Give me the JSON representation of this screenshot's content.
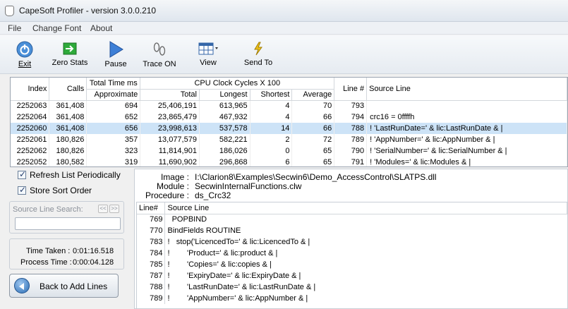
{
  "window": {
    "title": "CapeSoft Profiler - version  3.0.0.210"
  },
  "menu": [
    "File",
    "Change Font",
    "About"
  ],
  "toolbar": [
    {
      "label": "Exit",
      "icon": "power-icon"
    },
    {
      "label": "Zero Stats",
      "icon": "green-arrow-icon"
    },
    {
      "label": "Pause",
      "icon": "play-icon"
    },
    {
      "label": "Trace ON",
      "icon": "footprints-icon"
    },
    {
      "label": "View",
      "icon": "grid-view-icon"
    },
    {
      "label": "Send To",
      "icon": "lightning-icon"
    }
  ],
  "grid": {
    "header_top": [
      "Index",
      "Calls",
      "Total Time ms",
      "CPU Clock Cycles X 100",
      "Line #",
      "Source Line"
    ],
    "header_sub": [
      "Approximate",
      "Total",
      "Longest",
      "Shortest",
      "Average"
    ],
    "rows": [
      {
        "index": "2252063",
        "calls": "361,408",
        "approx": "694",
        "total": "25,406,191",
        "longest": "613,965",
        "shortest": "4",
        "average": "70",
        "line": "793",
        "source": ""
      },
      {
        "index": "2252064",
        "calls": "361,408",
        "approx": "652",
        "total": "23,865,479",
        "longest": "467,932",
        "shortest": "4",
        "average": "66",
        "line": "794",
        "source": "crc16 = 0ffffh"
      },
      {
        "index": "2252060",
        "calls": "361,408",
        "approx": "656",
        "total": "23,998,613",
        "longest": "537,578",
        "shortest": "14",
        "average": "66",
        "line": "788",
        "source": "!      'LastRunDate=' & lic:LastRunDate & |"
      },
      {
        "index": "2252061",
        "calls": "180,826",
        "approx": "357",
        "total": "13,077,579",
        "longest": "582,221",
        "shortest": "2",
        "average": "72",
        "line": "789",
        "source": "!      'AppNumber=' & lic:AppNumber & |"
      },
      {
        "index": "2252062",
        "calls": "180,826",
        "approx": "323",
        "total": "11,814,901",
        "longest": "186,026",
        "shortest": "0",
        "average": "65",
        "line": "790",
        "source": "!      'SerialNumber=' & lic:SerialNumber & |"
      },
      {
        "index": "2252052",
        "calls": "180,582",
        "approx": "319",
        "total": "11,690,902",
        "longest": "296,868",
        "shortest": "6",
        "average": "65",
        "line": "791",
        "source": "!      'Modules=' & lic:Modules & |"
      }
    ],
    "selected_index": 2
  },
  "options": {
    "refresh": "Refresh List Periodically",
    "store_sort": "Store Sort Order"
  },
  "search": {
    "label": "Source Line Search:",
    "prev": "<<",
    "next": ">>",
    "value": ""
  },
  "timers": {
    "taken_label": "Time Taken :",
    "taken_value": "0:01:16.518",
    "process_label": "Process Time :",
    "process_value": "0:00:04.128"
  },
  "back_button": "Back to Add Lines",
  "details": {
    "image_label": "Image :",
    "image_value": "I:\\Clarion8\\Examples\\Secwin6\\Demo_AccessControl\\SLATPS.dll",
    "module_label": "Module :",
    "module_value": "SecwinInternalFunctions.clw",
    "procedure_label": "Procedure :",
    "procedure_value": "ds_Crc32"
  },
  "source_grid": {
    "headers": [
      "Line#",
      "Source Line"
    ],
    "rows": [
      {
        "line": "769",
        "text": "  POPBIND"
      },
      {
        "line": "770",
        "text": "BindFields ROUTINE"
      },
      {
        "line": "783",
        "text": "!   stop('LicencedTo=' & lic:LicencedTo & |"
      },
      {
        "line": "784",
        "text": "!        'Product=' & lic:product & |"
      },
      {
        "line": "785",
        "text": "!        'Copies=' & lic:copies & |"
      },
      {
        "line": "787",
        "text": "!        'ExpiryDate=' & lic:ExpiryDate & |"
      },
      {
        "line": "788",
        "text": "!        'LastRunDate=' & lic:LastRunDate & |"
      },
      {
        "line": "789",
        "text": "!        'AppNumber=' & lic:AppNumber & |"
      }
    ]
  }
}
